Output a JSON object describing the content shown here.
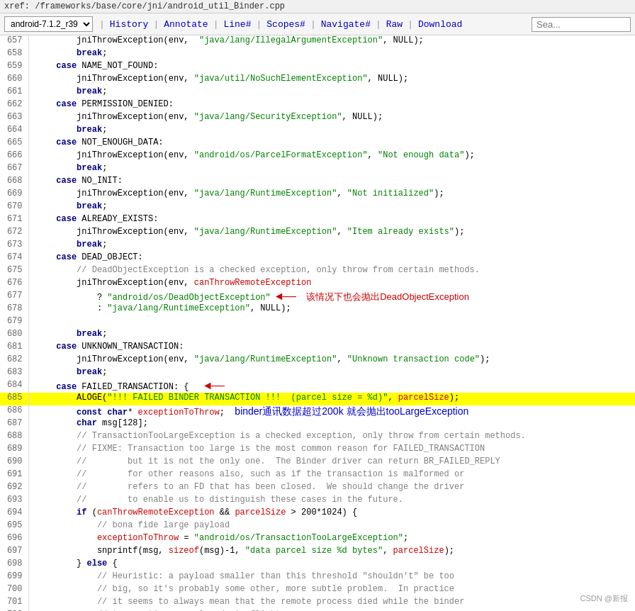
{
  "breadcrumb": {
    "text": "xref: /frameworks/base/core/jni/android_util_Binder.cpp"
  },
  "toolbar": {
    "version": "android-7.1.2_r39",
    "links": [
      "History",
      "Annotate",
      "Line#",
      "Scopes#",
      "Navigate#",
      "Raw",
      "Download"
    ],
    "search_placeholder": "Sea...",
    "search_value": ""
  },
  "watermark": "CSDN @新报"
}
